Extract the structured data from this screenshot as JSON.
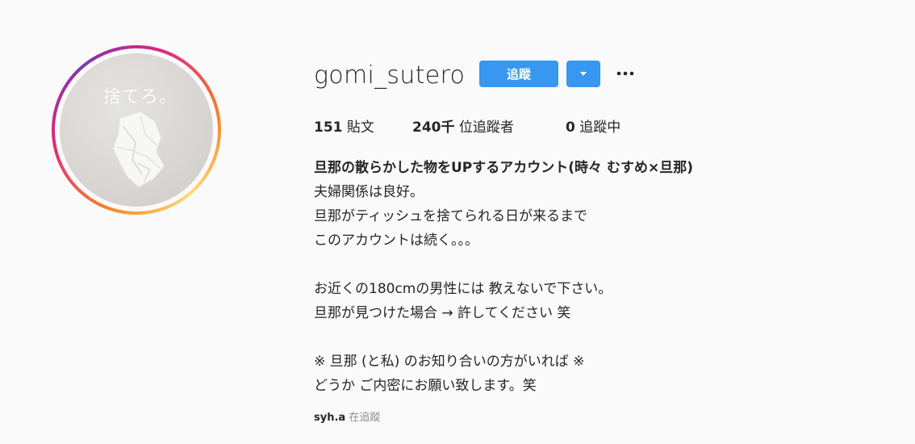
{
  "profile": {
    "avatar_text": "捨てろ。",
    "username": "gomi_sutero",
    "follow_label": "追蹤",
    "dropdown_icon": "caret-down-icon",
    "more_icon": "ellipsis-icon"
  },
  "stats": {
    "posts_value": "151",
    "posts_label": "貼文",
    "followers_value": "240千",
    "followers_label": "位追蹤者",
    "following_value": "0",
    "following_label": "追蹤中"
  },
  "bio": {
    "title": "旦那の散らかした物をUPするアカウント(時々 むすめ×旦那)",
    "lines": [
      "夫婦関係は良好。",
      "旦那がティッシュを捨てられる日が来るまで",
      "このアカウントは続く。。。",
      "",
      "お近くの180cmの男性には 教えないで下さい。",
      "旦那が見つけた場合 → 許してください 笑",
      "",
      "※ 旦那 (と私) のお知り合いの方がいれば ※",
      "どうか ご内密にお願い致します。笑"
    ]
  },
  "followed_by": {
    "user": "syh.a",
    "label": "在追蹤"
  },
  "colors": {
    "accent": "#3897f0",
    "text": "#262626",
    "muted": "#8e8e8e",
    "background": "#fafafa"
  }
}
